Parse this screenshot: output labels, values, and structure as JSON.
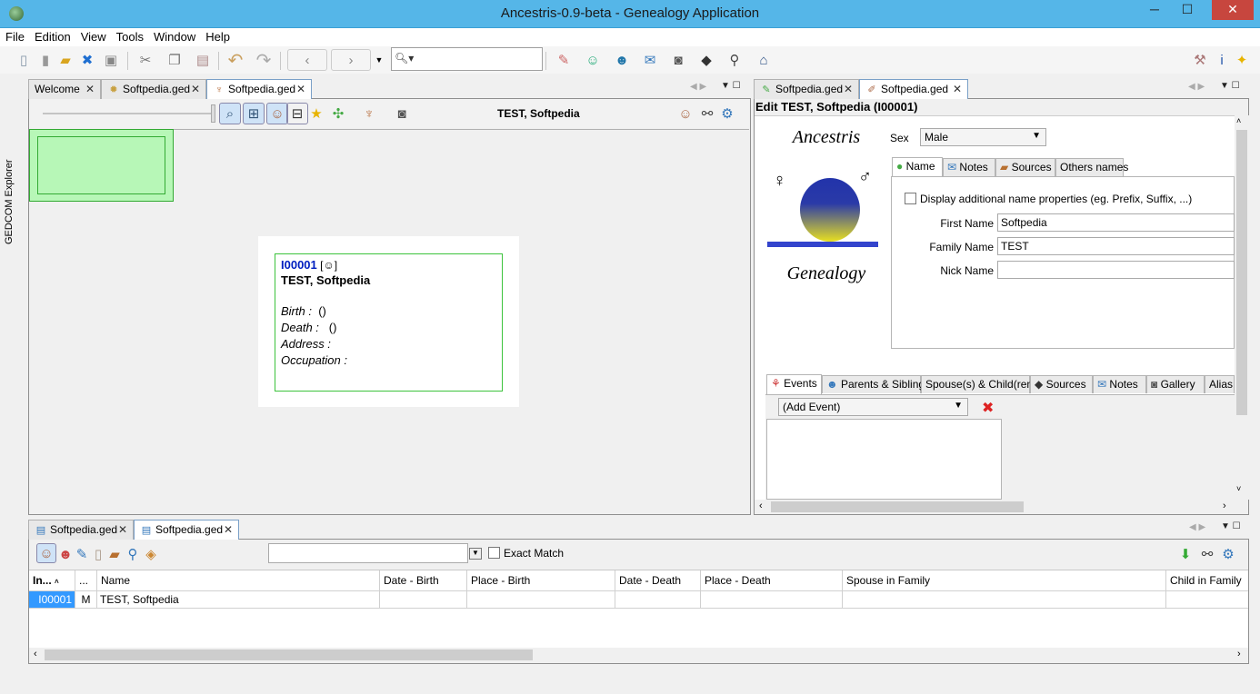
{
  "window": {
    "title": "Ancestris-0.9-beta - Genealogy Application",
    "minimize": "─",
    "maximize": "☐",
    "close": "✕"
  },
  "menu": [
    "File",
    "Edition",
    "View",
    "Tools",
    "Window",
    "Help"
  ],
  "sidebar": {
    "label": "GEDCOM Explorer"
  },
  "tree_panel": {
    "tabs": [
      {
        "label": "Welcome"
      },
      {
        "label": "Softpedia.ged"
      },
      {
        "label": "Softpedia.ged"
      }
    ],
    "header": "TEST, Softpedia",
    "card": {
      "id": "I00001",
      "name": "TEST, Softpedia",
      "birth_label": "Birth :",
      "birth_value": "()",
      "death_label": "Death :",
      "death_value": "()",
      "address_label": "Address :",
      "occupation_label": "Occupation :"
    }
  },
  "edit_panel": {
    "tabs": [
      {
        "label": "Softpedia.ged"
      },
      {
        "label": "Softpedia.ged"
      }
    ],
    "title": "Edit TEST, Softpedia (I00001)",
    "logo_top": "Ancestris",
    "logo_bottom": "Genealogy",
    "sex_label": "Sex",
    "sex_value": "Male",
    "name_tabs": [
      "Name",
      "Notes",
      "Sources",
      "Others names"
    ],
    "display_additional": "Display additional name properties (eg. Prefix, Suffix, ...)",
    "first_name_label": "First Name",
    "first_name_value": "Softpedia",
    "family_name_label": "Family Name",
    "family_name_value": "TEST",
    "nick_name_label": "Nick Name",
    "nick_name_value": "",
    "event_tabs": [
      "Events",
      "Parents & Sibling",
      "Spouse(s) & Child(ren)",
      "Sources",
      "Notes",
      "Gallery",
      "Alias"
    ],
    "add_event": "(Add Event)"
  },
  "list_panel": {
    "tabs": [
      {
        "label": "Softpedia.ged"
      },
      {
        "label": "Softpedia.ged"
      }
    ],
    "filter_value": "",
    "exact_match": "Exact Match",
    "columns": [
      "In...",
      "...",
      "Name",
      "Date - Birth",
      "Place - Birth",
      "Date - Death",
      "Place - Death",
      "Spouse in Family",
      "Child in Family"
    ],
    "rows": [
      {
        "id": "I00001",
        "sex": "M",
        "name": "TEST, Softpedia",
        "date_birth": "",
        "place_birth": "",
        "date_death": "",
        "place_death": "",
        "spouse": "",
        "child": ""
      }
    ]
  },
  "colors": {
    "titlebar": "#55b6e8",
    "close": "#c7463e",
    "card_border": "#3cc33c",
    "minimap": "#b7f7b7",
    "selected_row": "#3399ff"
  }
}
